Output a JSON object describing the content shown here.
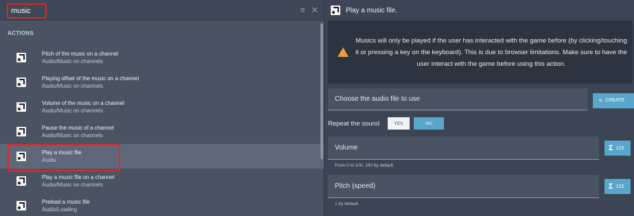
{
  "search": {
    "value": "music"
  },
  "left": {
    "section_title": "ACTIONS",
    "items": [
      {
        "title": "Pitch of the music on a channel",
        "subtitle": "Audio/Music on channels"
      },
      {
        "title": "Playing offset of the music on a channel",
        "subtitle": "Audio/Music on channels"
      },
      {
        "title": "Volume of the music on a channel",
        "subtitle": "Audio/Music on channels"
      },
      {
        "title": "Pause the music of a channel",
        "subtitle": "Audio/Music on channels"
      },
      {
        "title": "Play a music file",
        "subtitle": "Audio"
      },
      {
        "title": "Play a music file on a channel",
        "subtitle": "Audio/Music on channels"
      },
      {
        "title": "Preload a music file",
        "subtitle": "Audio/Loading"
      }
    ]
  },
  "right": {
    "header_title": "Play a music file.",
    "warning_text": "Musics will only be played if the user has interacted with the game before (by clicking/touching it or pressing a key on the keyboard). This is due to browser limitations. Make sure to have the user interact with the game before using this action.",
    "audio_field_placeholder": "Choose the audio file to use",
    "create_label": "CREATE",
    "repeat_label": "Repeat the sound",
    "yes_label": "YES",
    "no_label": "NO",
    "volume_label": "Volume",
    "volume_help": "From 0 to 100, 100 by default.",
    "pitch_label": "Pitch (speed)",
    "pitch_help": "1 by default.",
    "expr_label": "123"
  }
}
